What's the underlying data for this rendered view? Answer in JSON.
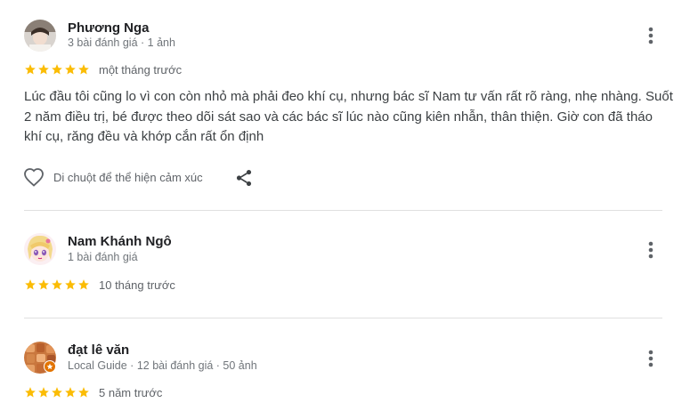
{
  "reviews": [
    {
      "name": "Phương Nga",
      "meta": "3 bài đánh giá · 1 ảnh",
      "rating": 5,
      "time": "một tháng trước",
      "text": "Lúc đầu tôi cũng lo vì con còn nhỏ mà phải đeo khí cụ, nhưng bác sĩ Nam tư vấn rất rõ ràng, nhẹ nhàng. Suốt 2 năm điều trị, bé được theo dõi sát sao và các bác sĩ lúc nào cũng kiên nhẫn, thân thiện. Giờ con đã tháo khí cụ, răng đều và khớp cắn rất ổn định",
      "react_label": "Di chuột để thể hiện cảm xúc"
    },
    {
      "name": "Nam Khánh Ngô",
      "meta": "1 bài đánh giá",
      "rating": 5,
      "time": "10 tháng trước"
    },
    {
      "name": "đạt lê văn",
      "meta": "Local Guide · 12 bài đánh giá · 50 ảnh",
      "rating": 5,
      "time": "5 năm trước"
    }
  ],
  "colors": {
    "star": "#fbbc04",
    "text": "#3c4043",
    "muted": "#70757a",
    "divider": "#e0e0e0",
    "local_guide_badge": "#e37400"
  },
  "icons": [
    "more-vert-icon",
    "heart-outline-icon",
    "share-icon",
    "star-icon",
    "local-guide-badge-icon"
  ]
}
